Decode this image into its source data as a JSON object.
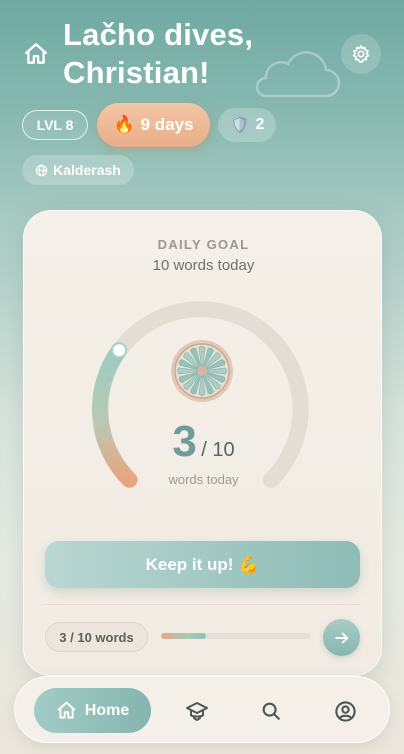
{
  "header": {
    "greeting": "Lačho dives, Christian!",
    "level": "LVL 8",
    "streak": {
      "emoji": "🔥",
      "label": "9 days"
    },
    "shield": {
      "emoji": "🛡️",
      "count": "2"
    },
    "language": "Kalderash"
  },
  "goal": {
    "label": "DAILY GOAL",
    "subtitle": "10 words today",
    "done": "3",
    "total": "/ 10",
    "caption": "words today",
    "progress_fraction": 0.3,
    "cta": "Keep it up! 💪",
    "progress_text": "3 / 10 words"
  },
  "nav": {
    "home_label": "Home"
  },
  "colors": {
    "accent_teal": "#86b6b0",
    "streak_orange": "#e9ad88",
    "ring_track": "#e3ddd4"
  },
  "icons": [
    "home-icon",
    "gear-icon",
    "cloud-icon",
    "globe-icon",
    "wheel-badge-icon",
    "arrow-right-icon",
    "graduation-cap-icon",
    "search-icon",
    "profile-icon"
  ]
}
